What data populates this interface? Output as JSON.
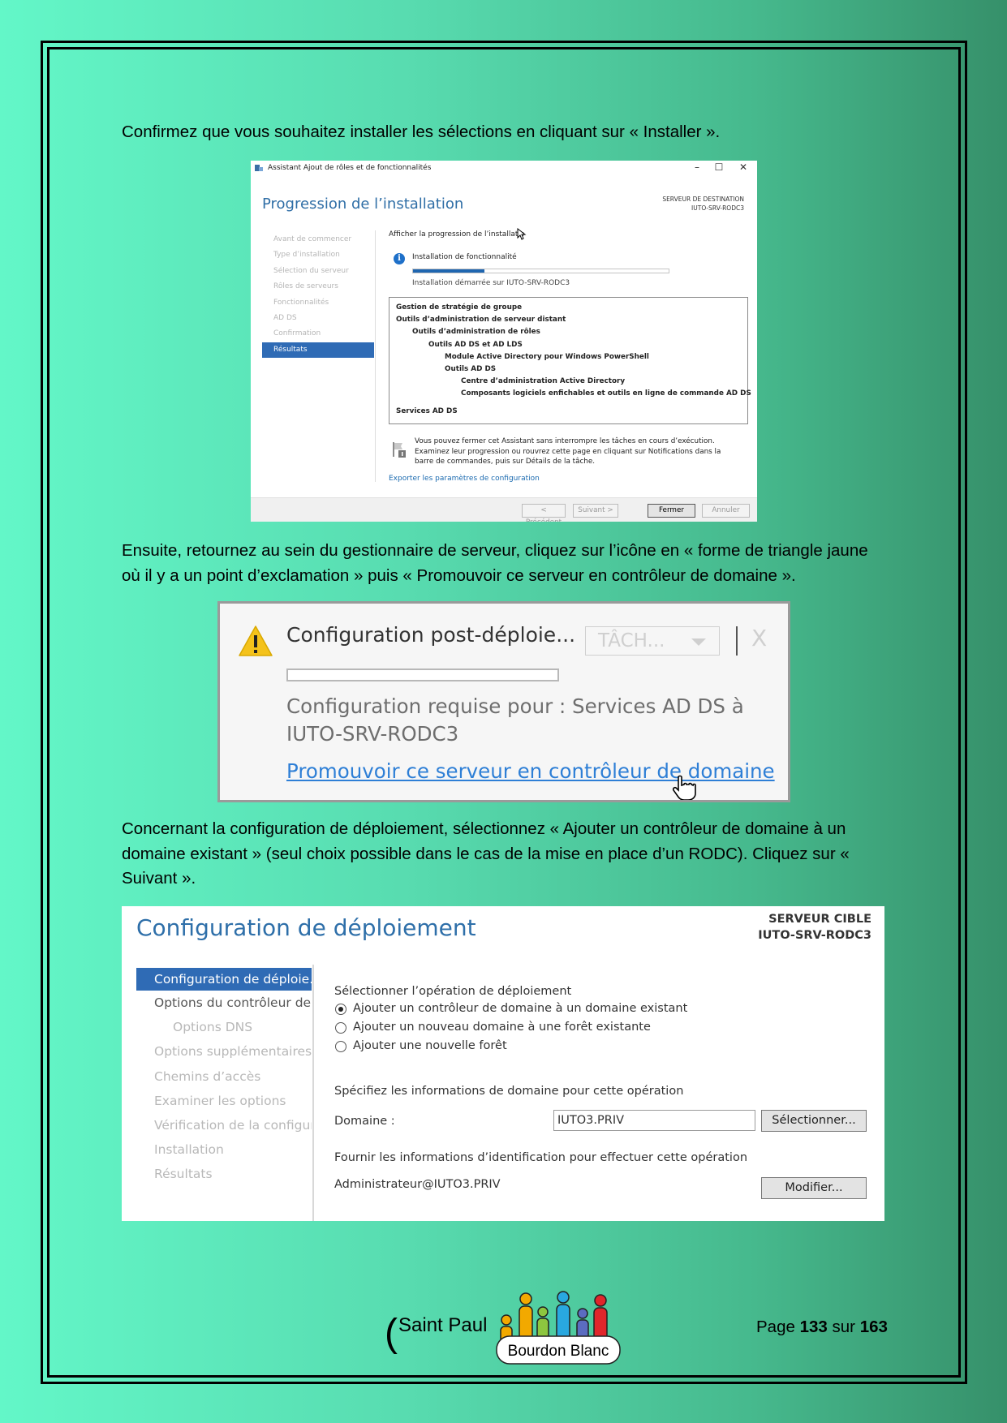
{
  "intro_text": "Confirmez que vous souhaitez installer les sélections en cliquant sur « Installer ».",
  "wizard": {
    "window_title": "Assistant Ajout de rôles et de fonctionnalités",
    "heading": "Progression de l’installation",
    "dest_label": "SERVEUR DE DESTINATION",
    "dest_server": "IUTO-SRV-RODC3",
    "nav": [
      "Avant de commencer",
      "Type d’installation",
      "Sélection du serveur",
      "Rôles de serveurs",
      "Fonctionnalités",
      "AD DS",
      "Confirmation",
      "Résultats"
    ],
    "progress_label": "Afficher la progression de l’installatio",
    "feature_label": "Installation de fonctionnalité",
    "progress_fraction": 0.28,
    "started_text": "Installation démarrée sur IUTO-SRV-RODC3",
    "tree": [
      {
        "text": "Gestion de stratégie de groupe",
        "level": 0
      },
      {
        "text": "Outils d’administration de serveur distant",
        "level": 0
      },
      {
        "text": "Outils d’administration de rôles",
        "level": 1
      },
      {
        "text": "Outils AD DS et AD LDS",
        "level": 2
      },
      {
        "text": "Module Active Directory pour Windows PowerShell",
        "level": 3
      },
      {
        "text": "Outils AD DS",
        "level": 3
      },
      {
        "text": "Centre d’administration Active Directory",
        "level": 4
      },
      {
        "text": "Composants logiciels enfichables et outils en ligne de commande AD DS",
        "level": 4
      },
      {
        "text": "Services AD DS",
        "level": 0
      }
    ],
    "note": "Vous pouvez fermer cet Assistant sans interrompre les tâches en cours d’exécution. Examinez leur progression ou rouvrez cette page en cliquant sur Notifications dans la barre de commandes, puis sur Détails de la tâche.",
    "export_link": "Exporter les paramètres de configuration",
    "btn_prev": "< Précédent",
    "btn_next": "Suivant >",
    "btn_close": "Fermer",
    "btn_cancel": "Annuler"
  },
  "para2": "Ensuite, retournez au sein du gestionnaire de serveur, cliquez sur l’icône en « forme de triangle jaune où il y a un point d’exclamation » puis « Promouvoir ce serveur en contrôleur de domaine ».",
  "notif": {
    "title": "Configuration post-déploie...",
    "tasks": "TÂCH...",
    "close": "X",
    "required": "Configuration requise pour : Services AD DS à IUTO-SRV-RODC3",
    "link": "Promouvoir ce serveur en contrôleur de domaine"
  },
  "para3": "Concernant la configuration de déploiement, sélectionnez « Ajouter un contrôleur de domaine à un domaine existant » (seul choix possible dans le cas de la mise en place d’un RODC). Cliquez sur « Suivant ».",
  "deploy": {
    "heading": "Configuration de déploiement",
    "target_label": "SERVEUR CIBLE",
    "target_server": "IUTO-SRV-RODC3",
    "nav": [
      {
        "label": "Configuration de déploie...",
        "state": "active"
      },
      {
        "label": "Options du contrôleur de...",
        "state": "dark"
      },
      {
        "label": "Options DNS",
        "state": "indent"
      },
      {
        "label": "Options supplémentaires",
        "state": ""
      },
      {
        "label": "Chemins d’accès",
        "state": ""
      },
      {
        "label": "Examiner les options",
        "state": ""
      },
      {
        "label": "Vérification de la configur...",
        "state": ""
      },
      {
        "label": "Installation",
        "state": ""
      },
      {
        "label": "Résultats",
        "state": ""
      }
    ],
    "select_op_label": "Sélectionner l’opération de déploiement",
    "options": [
      {
        "label": "Ajouter un contrôleur de domaine à un domaine existant",
        "selected": true
      },
      {
        "label": "Ajouter un nouveau domaine à une forêt existante",
        "selected": false
      },
      {
        "label": "Ajouter une nouvelle forêt",
        "selected": false
      }
    ],
    "domain_info_label": "Spécifiez les informations de domaine pour cette opération",
    "domain_label": "Domaine :",
    "domain_value": "IUTO3.PRIV",
    "select_button": "Sélectionner...",
    "creds_label": "Fournir les informations d’identification pour effectuer cette opération",
    "creds_value": "Administrateur@IUTO3.PRIV",
    "modify_button": "Modifier..."
  },
  "footer": {
    "paren": "(",
    "school": "Saint Paul",
    "logo_text": "Bourdon Blanc",
    "page_prefix": "Page",
    "page_current": "133",
    "page_sep": "sur",
    "page_total": "163"
  }
}
